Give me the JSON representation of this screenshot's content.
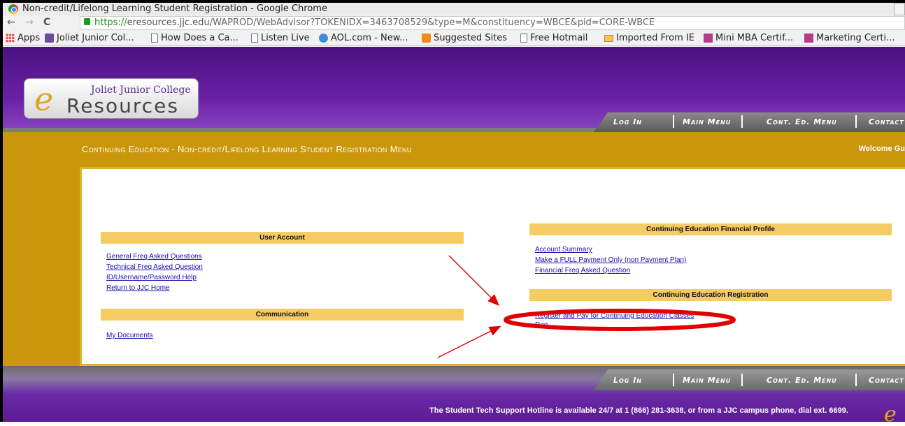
{
  "browser": {
    "window_title": "Non-credit/Lifelong Learning Student Registration - Google Chrome",
    "url_scheme": "https://",
    "url_host": "eresources.jjc.edu",
    "url_path": "/WAPROD/WebAdvisor?TOKENIDX=3463708529&type=M&constituency=WBCE&pid=CORE-WBCE",
    "bookmarks": [
      {
        "label": "Apps",
        "icon": "apps-grid-icon"
      },
      {
        "label": "Joliet Junior Col...",
        "icon": "jjc-icon"
      },
      {
        "label": "How Does a Ca...",
        "icon": "page-icon"
      },
      {
        "label": "Listen Live",
        "icon": "page-icon"
      },
      {
        "label": "AOL.com - New...",
        "icon": "aol-icon"
      },
      {
        "label": "Suggested Sites",
        "icon": "suggested-sites-icon"
      },
      {
        "label": "Free Hotmail",
        "icon": "page-icon"
      },
      {
        "label": "Imported From IE",
        "icon": "folder-icon"
      },
      {
        "label": "Mini MBA Certif...",
        "icon": "mba-icon"
      },
      {
        "label": "Marketing Certi...",
        "icon": "mba-icon"
      }
    ]
  },
  "site": {
    "logo_college": "Joliet Junior College",
    "logo_wordmark": "Resources",
    "logo_letter": "e",
    "nav": [
      "Log In",
      "Main Menu",
      "Cont. Ed. Menu",
      "Contact"
    ],
    "page_heading": "Continuing Education - Non-credit/Lifelong Learning Student Registration Menu",
    "welcome": "Welcome Gu",
    "sections": {
      "user_account": {
        "title": "User Account",
        "links": [
          "General Freq Asked Questions",
          "Technical Freq Asked Question",
          "ID/Username/Password Help",
          "Return to JJC Home"
        ]
      },
      "communication": {
        "title": "Communication",
        "links": [
          "My Documents"
        ]
      },
      "financial_profile": {
        "title": "Continuing Education Financial Profile",
        "links": [
          "Account Summary",
          "Make a FULL Payment Only (non Payment Plan)",
          "Financial Freq Asked Question"
        ]
      },
      "registration": {
        "title": "Continuing Education Registration",
        "links": [
          "Register and Pay for Continuing Education Classes",
          "Reg"
        ]
      }
    },
    "footer_nav": [
      "Log In",
      "Main Menu",
      "Cont. Ed. Menu",
      "Contact"
    ],
    "hotline": "The Student Tech Support Hotline is available 24/7 at 1 (866) 281-3638, or from a JJC campus phone, dial ext. 6699."
  },
  "colors": {
    "purple": "#6a20a6",
    "gold": "#c9960c",
    "section_header": "#f4cc63",
    "link": "#1a0dab",
    "annotation_red": "#e00000"
  }
}
